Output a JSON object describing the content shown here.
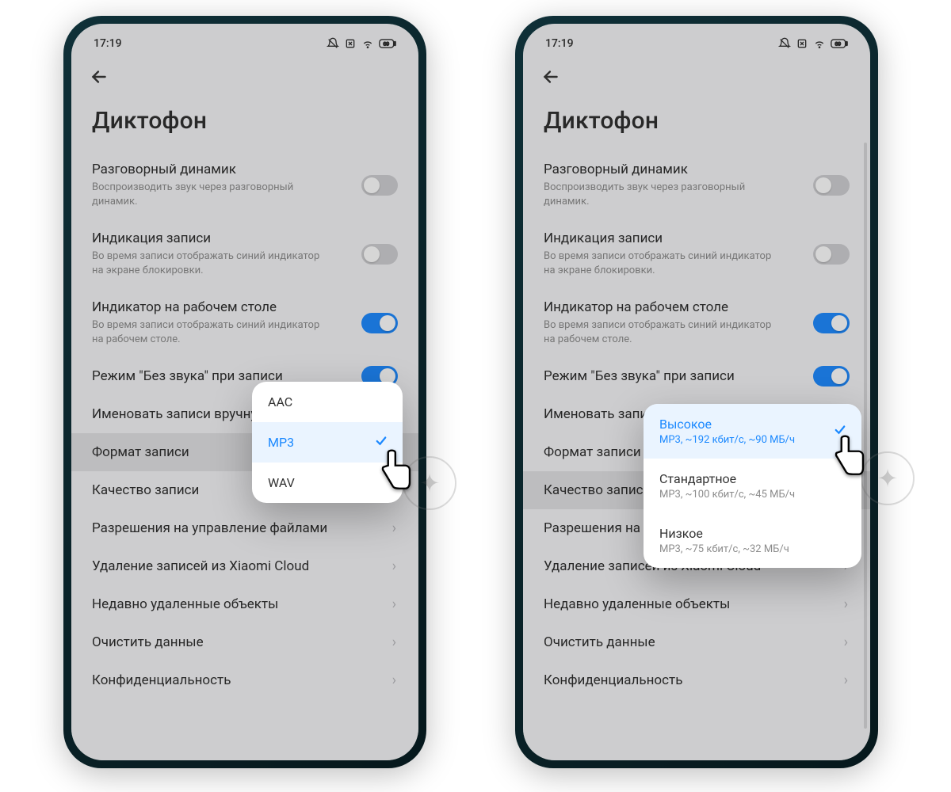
{
  "status": {
    "time": "17:19"
  },
  "page": {
    "title": "Диктофон",
    "rows": {
      "earpiece": {
        "label": "Разговорный динамик",
        "sub": "Воспроизводить звук через разговорный динамик."
      },
      "rec_ind": {
        "label": "Индикация записи",
        "sub": "Во время записи отображать синий индикатор на экране блокировки."
      },
      "home_ind": {
        "label": "Индикатор на рабочем столе",
        "sub": "Во время записи отображать синий индикатор на рабочем столе."
      },
      "silent": {
        "label": "Режим \"Без звука\" при записи"
      },
      "manual_left": {
        "label": "Именовать записи вручну"
      },
      "manual_right": {
        "label": "Именовать запи"
      },
      "format": {
        "label": "Формат записи"
      },
      "quality_left": {
        "label": "Качество записи"
      },
      "quality_right": {
        "label": "Качество запис"
      },
      "perms_left": {
        "label": "Разрешения на управление файлами"
      },
      "perms_right": {
        "label": "Разрешения на"
      },
      "cloud": {
        "label": "Удаление записей из Xiaomi Cloud"
      },
      "trash": {
        "label": "Недавно удаленные объекты"
      },
      "clear": {
        "label": "Очистить данные"
      },
      "privacy": {
        "label": "Конфиденциальность"
      }
    }
  },
  "format_popup": {
    "options": [
      {
        "label": "AAC"
      },
      {
        "label": "MP3"
      },
      {
        "label": "WAV"
      }
    ],
    "selected": 1
  },
  "quality_popup": {
    "options": [
      {
        "label": "Высокое",
        "sub": "MP3, ~192 кбит/с, ~90 МБ/ч"
      },
      {
        "label": "Стандартное",
        "sub": "MP3, ~100 кбит/с, ~45 МБ/ч"
      },
      {
        "label": "Низкое",
        "sub": "MP3, ~75 кбит/с, ~32 МБ/ч"
      }
    ],
    "selected": 0
  }
}
